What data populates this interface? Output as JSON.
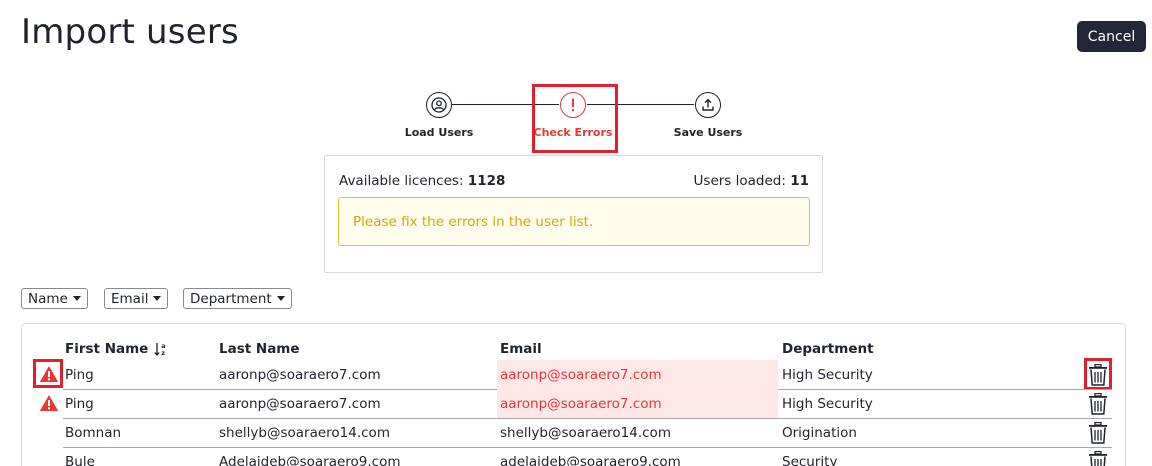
{
  "header": {
    "title": "Import users",
    "cancel_label": "Cancel"
  },
  "stepper": {
    "steps": [
      {
        "label": "Load Users",
        "icon": "user-circle-icon",
        "state": "done"
      },
      {
        "label": "Check Errors",
        "icon": "exclamation-icon",
        "state": "active"
      },
      {
        "label": "Save Users",
        "icon": "upload-icon",
        "state": "pending"
      }
    ],
    "active_color": "#e53935"
  },
  "summary": {
    "licences_label": "Available licences:",
    "licences_value": "1128",
    "loaded_label": "Users loaded:",
    "loaded_value": "11",
    "warning_text": "Please fix the errors in the user list."
  },
  "filters": [
    {
      "label": "Name"
    },
    {
      "label": "Email"
    },
    {
      "label": "Department"
    }
  ],
  "table": {
    "columns": [
      "First Name",
      "Last Name",
      "Email",
      "Department"
    ],
    "sort_icon": "sort-alpha-down-icon",
    "rows": [
      {
        "first": "Ping",
        "last": "aaronp@soaraero7.com",
        "email": "aaronp@soaraero7.com",
        "department": "High Security",
        "error": true
      },
      {
        "first": "Ping",
        "last": "aaronp@soaraero7.com",
        "email": "aaronp@soaraero7.com",
        "department": "High Security",
        "error": true
      },
      {
        "first": "Bomnan",
        "last": "shellyb@soaraero14.com",
        "email": "shellyb@soaraero14.com",
        "department": "Origination",
        "error": false
      },
      {
        "first": "Bule",
        "last": "Adelaideb@soaraero9.com",
        "email": "adelaideb@soaraero9.com",
        "department": "Security",
        "error": false
      }
    ]
  },
  "colors": {
    "error": "#e53935",
    "error_bg": "#fde7e7",
    "warning_border": "#e6c229",
    "warning_text": "#d4a80c",
    "button_dark": "#232637"
  }
}
